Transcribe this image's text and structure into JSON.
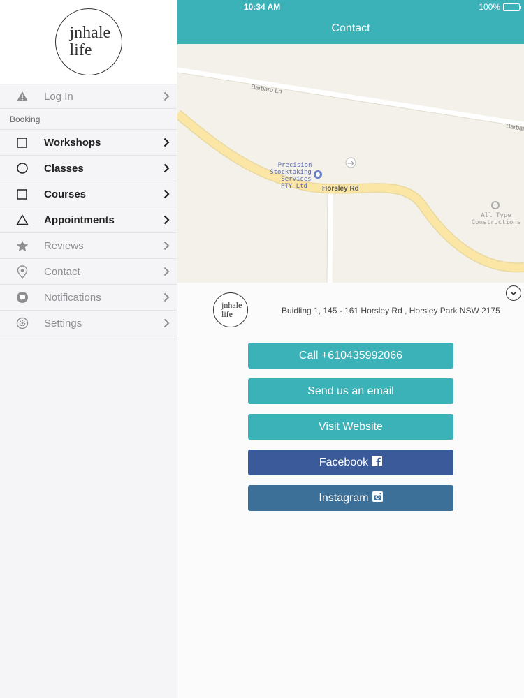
{
  "status_bar": {
    "time": "10:34 AM",
    "battery": "100%"
  },
  "sidebar": {
    "logo_line1": "jnhale",
    "logo_line2": "life",
    "login_label": "Log In",
    "section_booking": "Booking",
    "items": [
      {
        "label": "Workshops",
        "icon": "square-icon"
      },
      {
        "label": "Classes",
        "icon": "circle-icon"
      },
      {
        "label": "Courses",
        "icon": "square-icon"
      },
      {
        "label": "Appointments",
        "icon": "triangle-icon"
      },
      {
        "label": "Reviews",
        "icon": "star-icon"
      },
      {
        "label": "Contact",
        "icon": "map-pin-icon"
      },
      {
        "label": "Notifications",
        "icon": "chat-bubble-icon"
      },
      {
        "label": "Settings",
        "icon": "gear-icon"
      }
    ]
  },
  "header": {
    "title": "Contact"
  },
  "map": {
    "road_barbaro": "Barbaro Ln",
    "road_barbaro_edge": "Barbar",
    "road_horsley": "Horsley Rd",
    "poi_precision_1": "Precision",
    "poi_precision_2": "Stocktaking",
    "poi_precision_3": "Services",
    "poi_precision_4": "PTY Ltd",
    "poi_alltype_1": "All Type",
    "poi_alltype_2": "Constructions"
  },
  "contact": {
    "logo_line1": "jnhale",
    "logo_line2": "life",
    "address": "Buidling 1, 145 - 161 Horsley Rd , Horsley Park  NSW 2175",
    "call_label": "Call +610435992066",
    "email_label": "Send us an email",
    "website_label": "Visit Website",
    "facebook_label": "Facebook",
    "instagram_label": "Instagram"
  },
  "colors": {
    "accent": "#3bb2b8",
    "facebook": "#3b5a9a",
    "instagram": "#3d7099"
  }
}
